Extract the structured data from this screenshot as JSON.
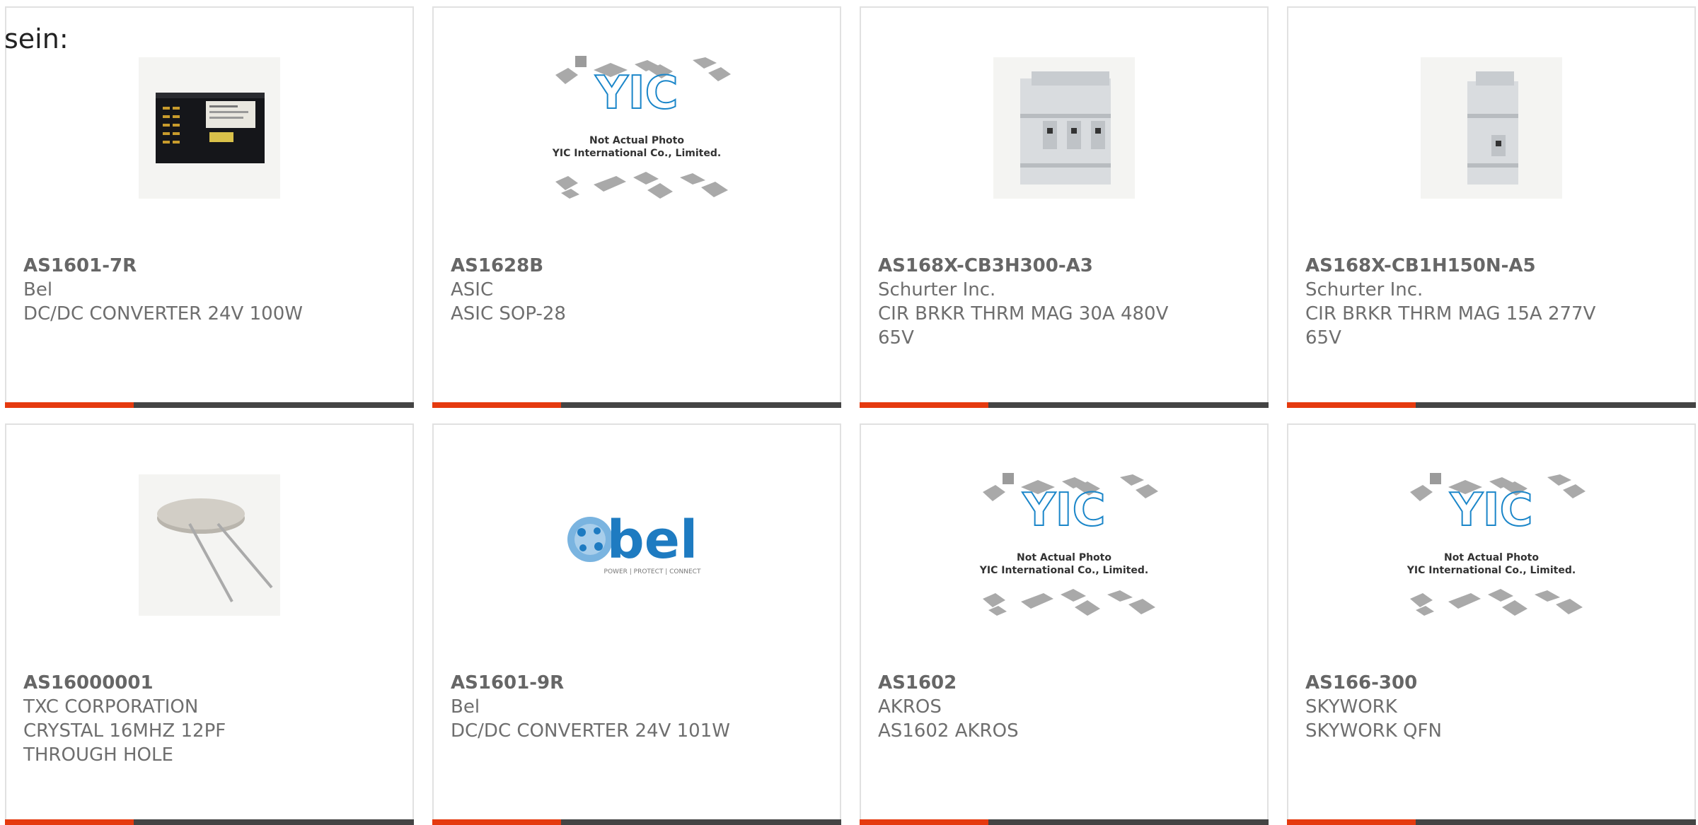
{
  "intro_text": "sein:",
  "colors": {
    "accent": "#e53a0f",
    "bar_dark": "#444444",
    "border": "#e1e1e1",
    "text": "#6e6e6e",
    "yic_blue": "#1b86c9",
    "bel_blue": "#1e7bc1"
  },
  "placeholder": {
    "line1": "Not Actual Photo",
    "line2": "YIC International Co., Limited.",
    "logo": "YIC"
  },
  "bel_logo": {
    "wordmark": "bel",
    "tagline": "POWER | PROTECT | CONNECT"
  },
  "products": [
    {
      "part_number": "AS1601-7R",
      "manufacturer": "Bel",
      "description": "DC/DC CONVERTER 24V 100W",
      "image": "dc-converter-photo"
    },
    {
      "part_number": "AS1628B",
      "manufacturer": "ASIC",
      "description": "ASIC SOP-28",
      "image": "yic-placeholder"
    },
    {
      "part_number": "AS168X-CB3H300-A3",
      "manufacturer": "Schurter Inc.",
      "description": "CIR BRKR THRM MAG 30A 480V 65V",
      "image": "breaker-3pole-photo"
    },
    {
      "part_number": "AS168X-CB1H150N-A5",
      "manufacturer": "Schurter Inc.",
      "description": "CIR BRKR THRM MAG 15A 277V 65V",
      "image": "breaker-1pole-photo"
    },
    {
      "part_number": "AS16000001",
      "manufacturer": "TXC CORPORATION",
      "description": "CRYSTAL 16MHZ 12PF THROUGH HOLE",
      "image": "crystal-photo"
    },
    {
      "part_number": "AS1601-9R",
      "manufacturer": "Bel",
      "description": "DC/DC CONVERTER 24V 101W",
      "image": "bel-logo"
    },
    {
      "part_number": "AS1602",
      "manufacturer": "AKROS",
      "description": "AS1602 AKROS",
      "image": "yic-placeholder"
    },
    {
      "part_number": "AS166-300",
      "manufacturer": "SKYWORK",
      "description": "SKYWORK QFN",
      "image": "yic-placeholder"
    }
  ]
}
